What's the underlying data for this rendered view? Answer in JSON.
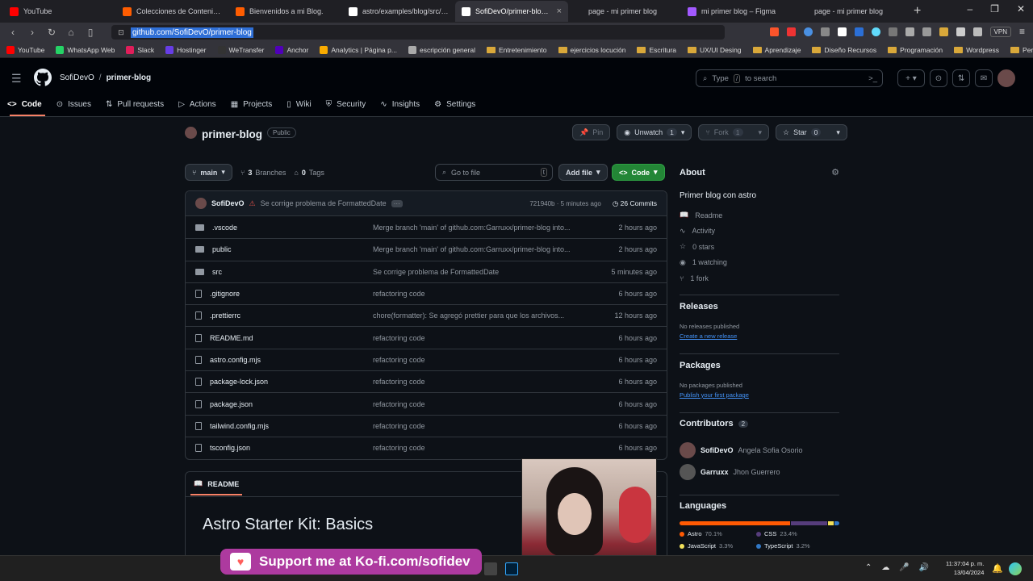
{
  "browser": {
    "tabs": [
      {
        "title": "YouTube",
        "fav_color": "#ff0000"
      },
      {
        "title": "Colecciones de Contenido | Do",
        "fav_color": "#ff5d01"
      },
      {
        "title": "Bienvenidos a mi Blog.",
        "fav_color": "#ff5d01"
      },
      {
        "title": "astro/examples/blog/src/page",
        "fav_color": "#ffffff"
      },
      {
        "title": "SofiDevO/primer-blog: Pri",
        "fav_color": "#ffffff",
        "active": true
      },
      {
        "title": "page - mi primer blog",
        "fav_color": "#1f1f24"
      },
      {
        "title": "mi primer blog – Figma",
        "fav_color": "#a259ff"
      },
      {
        "title": "page - mi primer blog",
        "fav_color": "#1f1f24"
      }
    ],
    "url": "github.com/SofiDevO/primer-blog",
    "vpn": "VPN",
    "bookmarks": [
      {
        "label": "YouTube",
        "color": "#ff0000"
      },
      {
        "label": "WhatsApp Web",
        "color": "#25d366"
      },
      {
        "label": "Slack",
        "color": "#e01e5a"
      },
      {
        "label": "Hostinger",
        "color": "#673de6"
      },
      {
        "label": "WeTransfer",
        "color": "#333"
      },
      {
        "label": "Anchor",
        "color": "#5000b9"
      },
      {
        "label": "Analytics | Página p...",
        "color": "#f9ab00"
      },
      {
        "label": "escripción general",
        "color": "#aaa"
      },
      {
        "label": "Entretenimiento",
        "folder": true
      },
      {
        "label": "ejercicios locución",
        "folder": true
      },
      {
        "label": "Escritura",
        "folder": true
      },
      {
        "label": "UX/UI Desing",
        "folder": true
      },
      {
        "label": "Aprendizaje",
        "folder": true
      },
      {
        "label": "Diseño Recursos",
        "folder": true
      },
      {
        "label": "Programación",
        "folder": true
      },
      {
        "label": "Wordpress",
        "folder": true
      },
      {
        "label": "Periodismo",
        "folder": true
      }
    ]
  },
  "github": {
    "owner": "SofiDevO",
    "separator": "/",
    "repo": "primer-blog",
    "search_pre": "Type",
    "search_key": "/",
    "search_post": "to search",
    "tabs": [
      "Code",
      "Issues",
      "Pull requests",
      "Actions",
      "Projects",
      "Wiki",
      "Security",
      "Insights",
      "Settings"
    ]
  },
  "repo": {
    "name": "primer-blog",
    "visibility": "Public",
    "pin": "Pin",
    "unwatch": "Unwatch",
    "unwatch_count": "1",
    "fork": "Fork",
    "fork_count": "1",
    "star": "Star",
    "star_count": "0",
    "branch": "main",
    "branches_count": "3",
    "branches_label": "Branches",
    "tags_count": "0",
    "tags_label": "Tags",
    "go_to_file": "Go to file",
    "go_key": "t",
    "add_file": "Add file",
    "code_btn": "Code",
    "commit_author": "SofiDevO",
    "commit_msg": "Se corrige problema de FormattedDate",
    "commit_hash": "721940b · 5 minutes ago",
    "commits": "26 Commits",
    "files": [
      {
        "name": ".vscode",
        "type": "dir",
        "msg": "Merge branch 'main' of github.com:Garruxx/primer-blog into...",
        "time": "2 hours ago"
      },
      {
        "name": "public",
        "type": "dir",
        "msg": "Merge branch 'main' of github.com:Garruxx/primer-blog into...",
        "time": "2 hours ago"
      },
      {
        "name": "src",
        "type": "dir",
        "msg": "Se corrige problema de FormattedDate",
        "time": "5 minutes ago"
      },
      {
        "name": ".gitignore",
        "type": "file",
        "msg": "refactoring code",
        "time": "6 hours ago"
      },
      {
        "name": ".prettierrc",
        "type": "file",
        "msg": "chore(formatter): Se agregó prettier para que los archivos...",
        "time": "12 hours ago"
      },
      {
        "name": "README.md",
        "type": "file",
        "msg": "refactoring code",
        "time": "6 hours ago"
      },
      {
        "name": "astro.config.mjs",
        "type": "file",
        "msg": "refactoring code",
        "time": "6 hours ago"
      },
      {
        "name": "package-lock.json",
        "type": "file",
        "msg": "refactoring code",
        "time": "6 hours ago"
      },
      {
        "name": "package.json",
        "type": "file",
        "msg": "refactoring code",
        "time": "6 hours ago"
      },
      {
        "name": "tailwind.config.mjs",
        "type": "file",
        "msg": "refactoring code",
        "time": "6 hours ago"
      },
      {
        "name": "tsconfig.json",
        "type": "file",
        "msg": "refactoring code",
        "time": "6 hours ago"
      }
    ],
    "readme_label": "README",
    "readme_title": "Astro Starter Kit: Basics"
  },
  "about": {
    "heading": "About",
    "description": "Primer blog con astro",
    "items": [
      "Readme",
      "Activity",
      "0 stars",
      "1 watching",
      "1 fork"
    ],
    "releases": "Releases",
    "no_releases": "No releases published",
    "create_release": "Create a new release",
    "packages": "Packages",
    "no_packages": "No packages published",
    "publish_package": "Publish your first package",
    "contributors": "Contributors",
    "contributors_count": "2",
    "contrib": [
      {
        "user": "SofiDevO",
        "name": "Angela Sofia Osorio"
      },
      {
        "user": "Garruxx",
        "name": "Jhon Guerrero"
      }
    ],
    "languages": "Languages",
    "langs": [
      {
        "name": "Astro",
        "pct": "70.1%",
        "color": "#ff5a03",
        "share": 70.1
      },
      {
        "name": "CSS",
        "pct": "23.4%",
        "color": "#563d7c",
        "share": 23.4
      },
      {
        "name": "JavaScript",
        "pct": "3.3%",
        "color": "#f1e05a",
        "share": 3.3
      },
      {
        "name": "TypeScript",
        "pct": "3.2%",
        "color": "#3178c6",
        "share": 3.2
      }
    ]
  },
  "overlay": {
    "kofi": "Support me at Ko-fi.com/sofidev"
  },
  "taskbar": {
    "time": "11:37:04 p. m.",
    "date": "13/04/2024"
  }
}
